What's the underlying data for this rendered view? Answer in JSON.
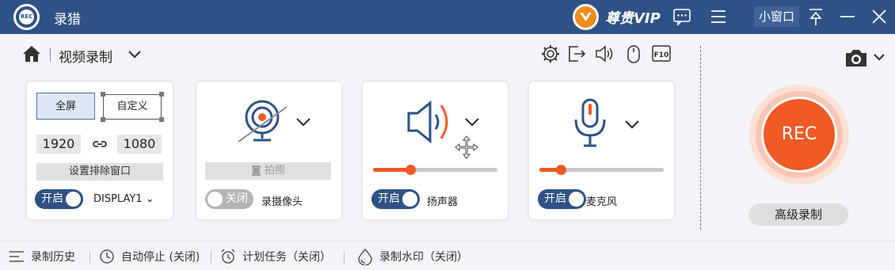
{
  "titlebar": {
    "logo_text": "REC",
    "app_title": "录猎",
    "vip_label": "尊贵VIP",
    "mini_window_label": "小窗口"
  },
  "toolbar": {
    "breadcrumb": "视频录制"
  },
  "screen_panel": {
    "fullscreen_label": "全屏",
    "custom_label": "自定义",
    "width": "1920",
    "height": "1080",
    "exclude_window_label": "设置排除窗口",
    "toggle_label": "开启",
    "display_select": "DISPLAY1"
  },
  "camera_panel": {
    "snapshot_label": "拍照",
    "toggle_label": "关闭",
    "label": "录摄像头"
  },
  "speaker_panel": {
    "toggle_label": "开启",
    "label": "扬声器",
    "volume": 0.3
  },
  "mic_panel": {
    "toggle_label": "开启",
    "label": "麦克风",
    "volume": 0.17
  },
  "rec": {
    "label": "REC",
    "advanced_label": "高级录制"
  },
  "bottombar": {
    "history": "录制历史",
    "auto_stop": "自动停止 (关闭)",
    "schedule": "计划任务（关闭）",
    "watermark": "录制水印（关闭）"
  },
  "colors": {
    "titlebar": "#2e5285",
    "accent": "#f05a24",
    "toggle_on": "#2e5285"
  }
}
